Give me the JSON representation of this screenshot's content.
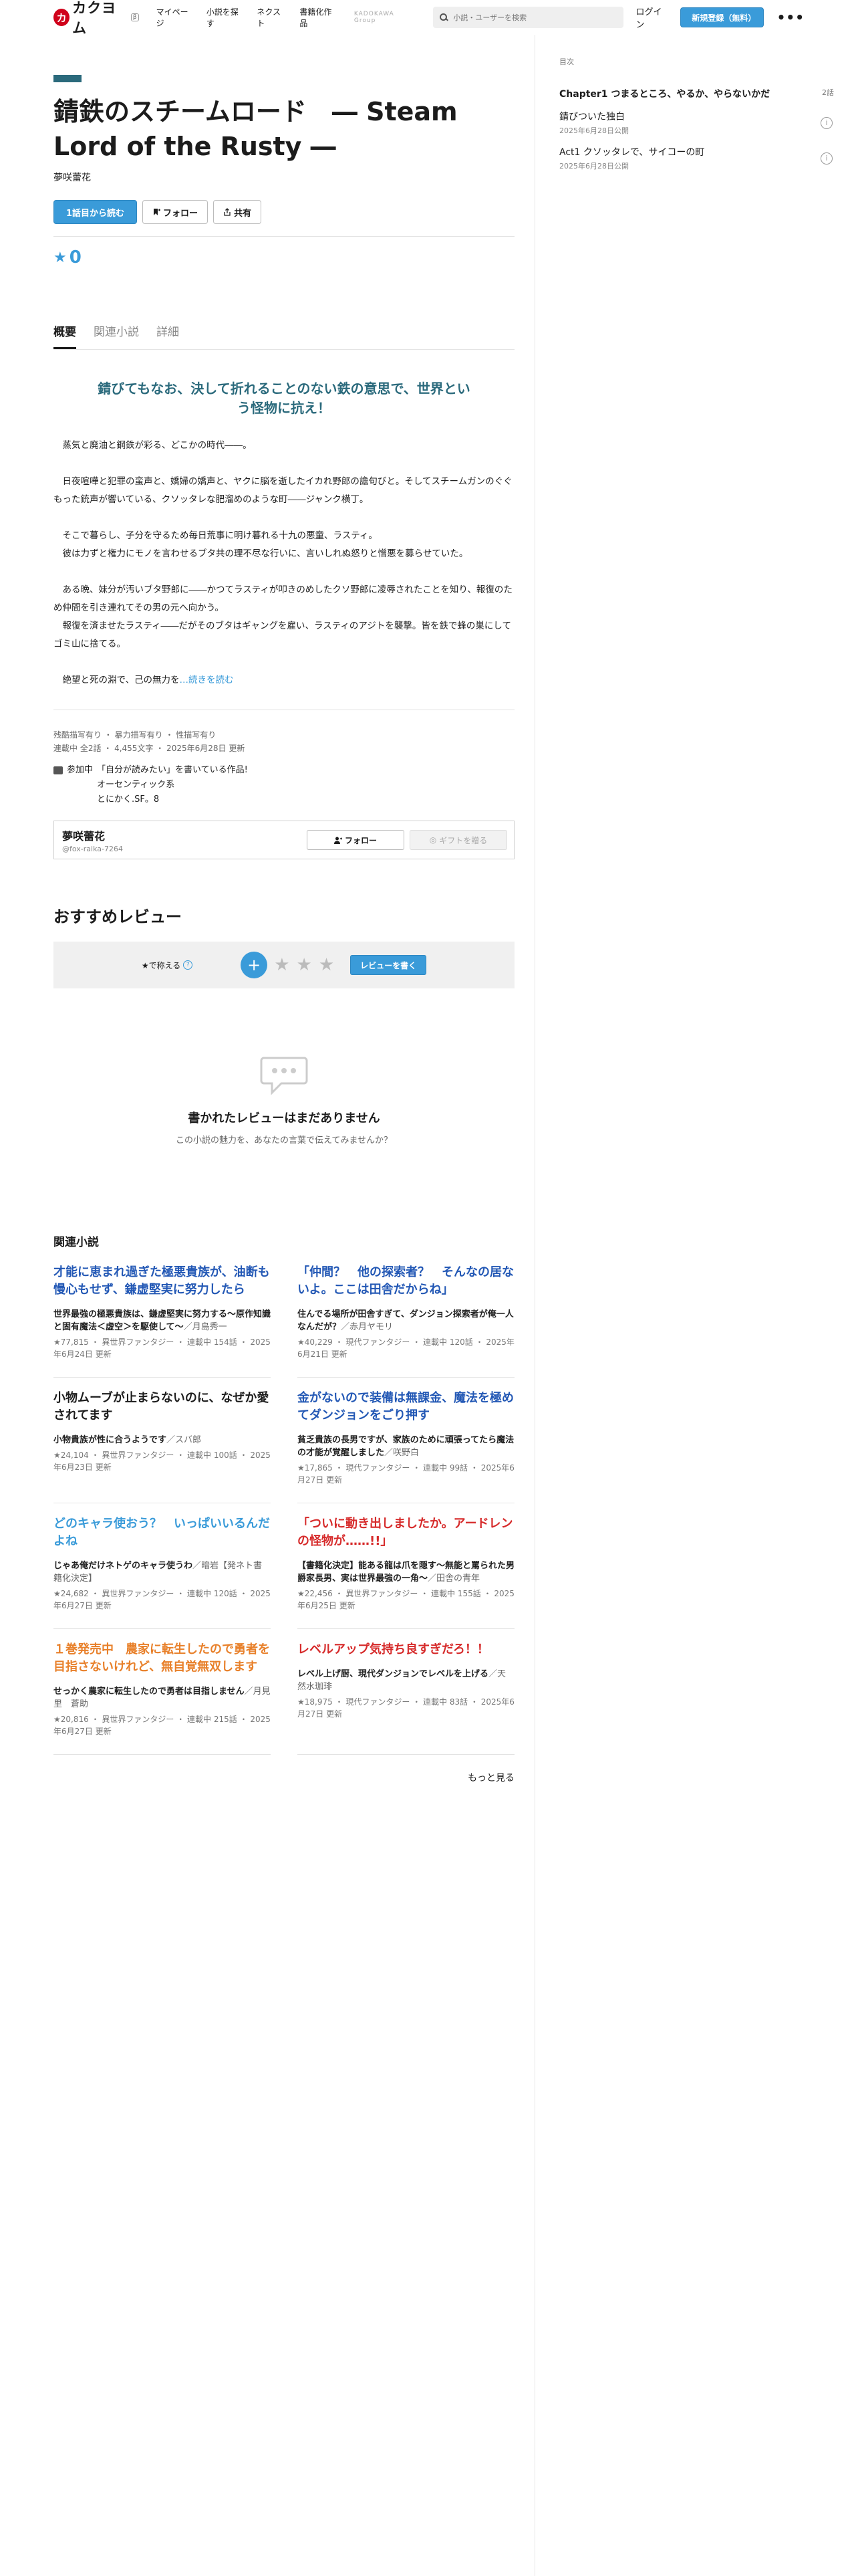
{
  "header": {
    "logo_glyph": "カ",
    "logo_text": "カクヨム",
    "logo_tag": "β",
    "nav": [
      "マイページ",
      "小説を探す",
      "ネクスト",
      "書籍化作品"
    ],
    "group_label": "KADOKAWA Group",
    "search_placeholder": "小説・ユーザーを検索",
    "login": "ログイン",
    "signup": "新規登録（無料）",
    "menu": "•••"
  },
  "sidebar": {
    "toc_title": "目次",
    "chapter_title": "Chapter1 つまるところ、やるか、やらないかだ",
    "chapter_count": "2話",
    "episodes": [
      {
        "title": "錆びついた独白",
        "date": "2025年6月28日公開"
      },
      {
        "title": "Act1 クソッタレで、サイコーの町",
        "date": "2025年6月28日公開"
      }
    ]
  },
  "work": {
    "title": "錆鉄のスチームロード　― Steam Lord of the Rusty ―",
    "author": "夢咲蕾花",
    "read_first": "1話目から読む",
    "follow": "フォロー",
    "share": "共有",
    "rating_star": "★",
    "rating": "0"
  },
  "tabs": [
    "概要",
    "関連小説",
    "詳細"
  ],
  "summary": {
    "catch": "錆びてもなお、決して折れることのない鉄の意思で、世界という怪物に抗え！",
    "paragraphs": [
      "　蒸気と廃油と鋼鉄が彩る、どこかの時代――。",
      "　日夜喧嘩と犯罪の蛮声と、嬌婦の嬌声と、ヤクに脳を逝したイカれ野郎の譫句びと。そしてスチームガンのぐぐもった銃声が響いている、クソッタレな肥溜めのような町――ジャンク横丁。",
      "　そこで暮らし、子分を守るため毎日荒事に明け暮れる十九の悪童、ラスティ。\n　彼は力ずと権力にモノを言わせるブタ共の理不尽な行いに、言いしれぬ怒りと憎悪を募らせていた。",
      "　ある晩、妹分が汚いブタ野郎に――かつてラスティが叩きのめしたクソ野郎に凌辱されたことを知り、報復のため仲間を引き連れてその男の元へ向かう。\n　報復を済ませたラスティ――だがそのブタはギャングを雇い、ラスティのアジトを襲撃。皆を鉄で蜂の巣にしてゴミ山に捨てる。",
      "　絶望と死の淵で、己の無力を"
    ],
    "read_more": "…続きを読む"
  },
  "info": {
    "tags": "残酷描写有り ・ 暴力描写有り ・ 性描写有り",
    "meta": "連載中 全2話 ・ 4,455文字 ・ 2025年6月28日 更新",
    "contest_label": "参加中",
    "contest_lines": [
      "「自分が読みたい」を書いている作品!",
      "オーセンティック系",
      "とにかく.SF。8"
    ]
  },
  "author_card": {
    "name": "夢咲蕾花",
    "id": "@fox-raika-7264",
    "follow": "フォロー",
    "gift": "ギフトを贈る"
  },
  "reviews": {
    "title": "おすすめレビュー",
    "label": "★で称える",
    "write": "レビューを書く",
    "empty_title": "書かれたレビューはまだありません",
    "empty_sub": "この小説の魅力を、あなたの言葉で伝えてみませんか？"
  },
  "related": {
    "title": "関連小説",
    "items": [
      {
        "title": "才能に恵まれ過ぎた極悪貴族が、油断も慢心もせず、鎌虚堅実に努力したら",
        "color": "#2358b5",
        "catch": "世界最強の極悪貴族は、鎌虚堅実に努力する〜原作知識と固有魔法＜虚空＞を駆使して〜",
        "author": "／月島秀一",
        "meta": "★77,815 ・ 異世界ファンタジー ・ 連載中 154話 ・ 2025年6月24日 更新"
      },
      {
        "title": "「仲間？　他の探索者？　そんなの居ないよ。ここは田舎だからね」",
        "color": "#2358b5",
        "catch": "住んでる場所が田舎すぎて、ダンジョン探索者が俺一人なんだが？",
        "author": "／赤月ヤモリ",
        "meta": "★40,229 ・ 現代ファンタジー ・ 連載中 120話 ・ 2025年6月21日 更新"
      },
      {
        "title": "小物ムーブが止まらないのに、なぜか愛されてます",
        "color": "#1c1c1c",
        "catch": "小物貴族が性に合うようです",
        "author": "／スバ郎",
        "meta": "★24,104 ・ 異世界ファンタジー ・ 連載中 100話 ・ 2025年6月23日 更新"
      },
      {
        "title": "金がないので装備は無課金、魔法を極めてダンジョンをごり押す",
        "color": "#2358b5",
        "catch": "貧乏貴族の長男ですが、家族のために頑張ってたら魔法の才能が覚醒しました",
        "author": "／咲野白",
        "meta": "★17,865 ・ 現代ファンタジー ・ 連載中 99話 ・ 2025年6月27日 更新"
      },
      {
        "title": "どのキャラ使おう？　いっぱいいるんだよね",
        "color": "#3a9bd9",
        "catch": "じゃあ俺だけネトゲのキャラ使うわ",
        "author": "／暗岩【発ネト書籍化決定】",
        "meta": "★24,682 ・ 異世界ファンタジー ・ 連載中 120話 ・ 2025年6月27日 更新"
      },
      {
        "title": "「ついに動き出しましたか。アードレンの怪物が……!!」",
        "color": "#d62a2a",
        "catch": "【書籍化決定】能ある龍は爪を隠す〜無能と罵られた男爵家長男、実は世界最強の一角〜",
        "author": "／田舎の青年",
        "meta": "★22,456 ・ 異世界ファンタジー ・ 連載中 155話 ・ 2025年6月25日 更新"
      },
      {
        "title": "１巻発売中　農家に転生したので勇者を目指さないけれど、無自覚無双します",
        "color": "#e8802a",
        "catch": "せっかく農家に転生したので勇者は目指しません",
        "author": "／月見里　蒼助",
        "meta": "★20,816 ・ 異世界ファンタジー ・ 連載中 215話 ・ 2025年6月27日 更新"
      },
      {
        "title": "レベルアップ気持ち良すぎだろ！！",
        "color": "#d62a2a",
        "catch": "レベル上げ厨、現代ダンジョンでレベルを上げる",
        "author": "／天然水珈琲",
        "meta": "★18,975 ・ 現代ファンタジー ・ 連載中 83話 ・ 2025年6月27日 更新"
      }
    ],
    "more": "もっと見る"
  }
}
